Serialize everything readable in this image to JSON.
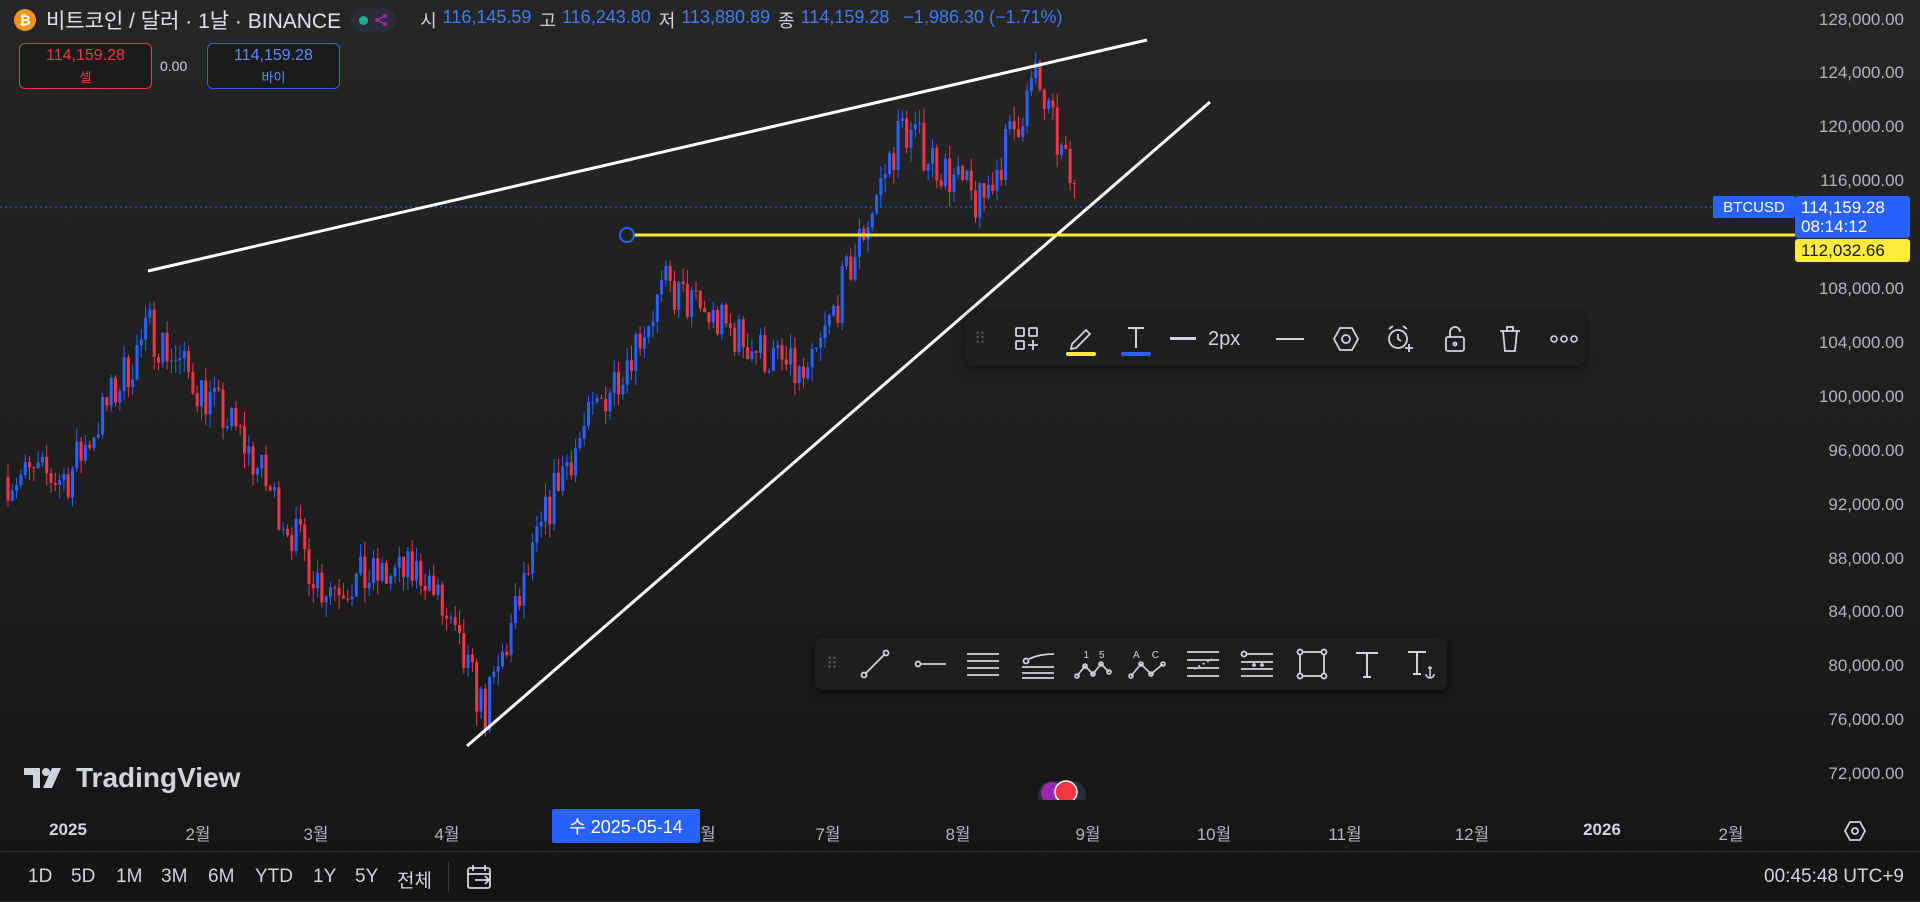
{
  "header": {
    "coin_icon": "bitcoin-icon",
    "title": "비트코인 / 달러 · 1날 · BINANCE",
    "ohlc": [
      {
        "label": "시",
        "value": "116,145.59"
      },
      {
        "label": "고",
        "value": "116,243.80"
      },
      {
        "label": "저",
        "value": "113,880.89"
      },
      {
        "label": "종",
        "value": "114,159.28"
      }
    ],
    "change": "−1,986.30 (−1.71%)"
  },
  "trade": {
    "sell_price": "114,159.28",
    "sell_label": "셀",
    "spread": "0.00",
    "buy_price": "114,159.28",
    "buy_label": "바이"
  },
  "price_axis": {
    "labels": [
      "128,000.00",
      "124,000.00",
      "120,000.00",
      "116,000.00",
      "108,000.00",
      "104,000.00",
      "100,000.00",
      "96,000.00",
      "92,000.00",
      "88,000.00",
      "84,000.00",
      "80,000.00",
      "76,000.00",
      "72,000.00"
    ],
    "symbol_tag": "BTCUSD",
    "last_price": "114,159.28",
    "countdown": "08:14:12",
    "hline_price": "112,032.66"
  },
  "drawing_props_toolbar": {
    "line_width_label": "2px",
    "items": [
      "grip-icon",
      "add-to-favorites-icon",
      "pencil-color-icon",
      "text-color-icon",
      "line-width-icon",
      "line-style-icon",
      "settings-hexagon-icon",
      "add-alert-icon",
      "lock-icon",
      "trash-icon",
      "more-icon"
    ],
    "colors": {
      "pencil_underline": "#ffeb3b",
      "text_underline": "#2962ff"
    }
  },
  "drawing_tools_toolbar": {
    "items": [
      "grip-icon",
      "trend-line-icon",
      "horizontal-ray-icon",
      "parallel-channel-icon",
      "regression-trend-icon",
      "xabcd-pattern-icon",
      "abcd-pattern-icon",
      "fib-retracement-icon",
      "fib-extension-icon",
      "rectangle-icon",
      "text-icon",
      "anchored-text-icon"
    ],
    "xabcd_labels": [
      "1",
      "5"
    ],
    "abcd_labels": [
      "A",
      "C"
    ]
  },
  "time_axis": {
    "labels": [
      "2025",
      "2월",
      "3월",
      "4월",
      "월",
      "7월",
      "8월",
      "9월",
      "10월",
      "11월",
      "12월",
      "2026",
      "2월"
    ],
    "crosshair_date": "수 2025-05-14"
  },
  "bottom_bar": {
    "ranges": [
      "1D",
      "5D",
      "1M",
      "3M",
      "6M",
      "YTD",
      "1Y",
      "5Y",
      "전체"
    ],
    "clock": "00:45:48 UTC+9"
  },
  "branding": {
    "logo_text": "TradingView"
  },
  "chart_data": {
    "type": "candlestick",
    "symbol": "BTCUSD",
    "interval": "1D",
    "ylim": [
      70000,
      129000
    ],
    "last_close": 114159.28,
    "horizontal_line": 112032.66,
    "trend_lines": [
      {
        "from": [
          "2025-01-20",
          109500
        ],
        "to": [
          "2025-09-20",
          126800
        ]
      },
      {
        "from": [
          "2025-04-07",
          74500
        ],
        "to": [
          "2025-09-30",
          121500
        ]
      }
    ],
    "series_approx_close": [
      {
        "x": "2025-01-01",
        "y": 94000
      },
      {
        "x": "2025-01-20",
        "y": 105000
      },
      {
        "x": "2025-02-10",
        "y": 97000
      },
      {
        "x": "2025-03-01",
        "y": 86000
      },
      {
        "x": "2025-03-25",
        "y": 87000
      },
      {
        "x": "2025-04-08",
        "y": 76500
      },
      {
        "x": "2025-04-25",
        "y": 94000
      },
      {
        "x": "2025-05-20",
        "y": 108000
      },
      {
        "x": "2025-06-22",
        "y": 101000
      },
      {
        "x": "2025-07-14",
        "y": 120000
      },
      {
        "x": "2025-08-01",
        "y": 114000
      },
      {
        "x": "2025-08-14",
        "y": 123500
      },
      {
        "x": "2025-08-24",
        "y": 114159.28
      }
    ]
  },
  "colors": {
    "up": "#2962ff",
    "down": "#f23645",
    "accent": "#2962ff",
    "hline": "#ffeb3b"
  }
}
